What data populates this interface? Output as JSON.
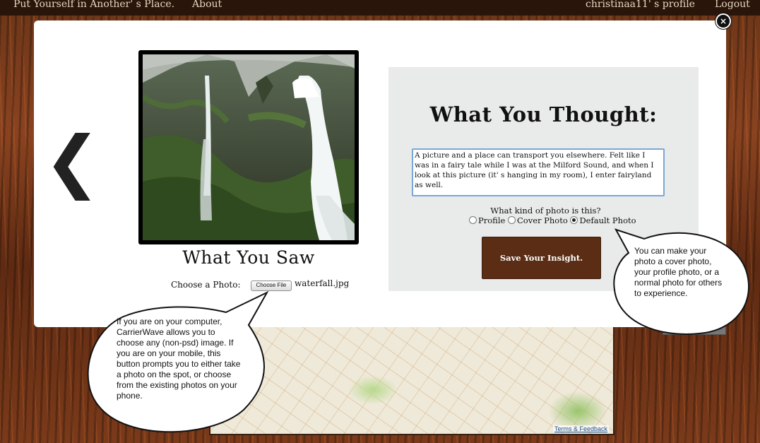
{
  "nav": {
    "site_title": "Put Yourself in Another' s Place.",
    "about": "About",
    "profile": "christinaa11' s profile",
    "logout": "Logout"
  },
  "modal": {
    "close_glyph": "×",
    "prev_glyph": "❮",
    "saw": {
      "title": "What You Saw",
      "choose_label": "Choose a Photo:",
      "file_button": "Choose File",
      "file_name": "waterfall.jpg"
    },
    "thought": {
      "title": "What You Thought:",
      "insight_text": "A picture and a place can transport you elsewhere. Felt like I was in a fairy tale while I was at the Milford Sound, and when I look at this picture (it' s hanging in my room), I enter fairyland as well.",
      "kind_question": "What kind of photo is this?",
      "options": [
        "Profile",
        "Cover Photo",
        "Default Photo"
      ],
      "selected": "Default Photo",
      "save_button": "Save Your Insight."
    }
  },
  "bubbles": {
    "left": "If you are on your computer, CarrierWave allows you to choose any (non-psd) image. If you are on your mobile, this button prompts you to either take a photo on the spot, or choose from the existing photos on your phone.",
    "right": "You can make your photo a cover photo, your profile photo, or a normal photo for others to experience."
  },
  "map": {
    "terms": "Terms & Feedback"
  },
  "colors": {
    "accent_brown": "#5a2d14",
    "topbar": "#2a150a",
    "panel_gray": "#e8ebea"
  }
}
